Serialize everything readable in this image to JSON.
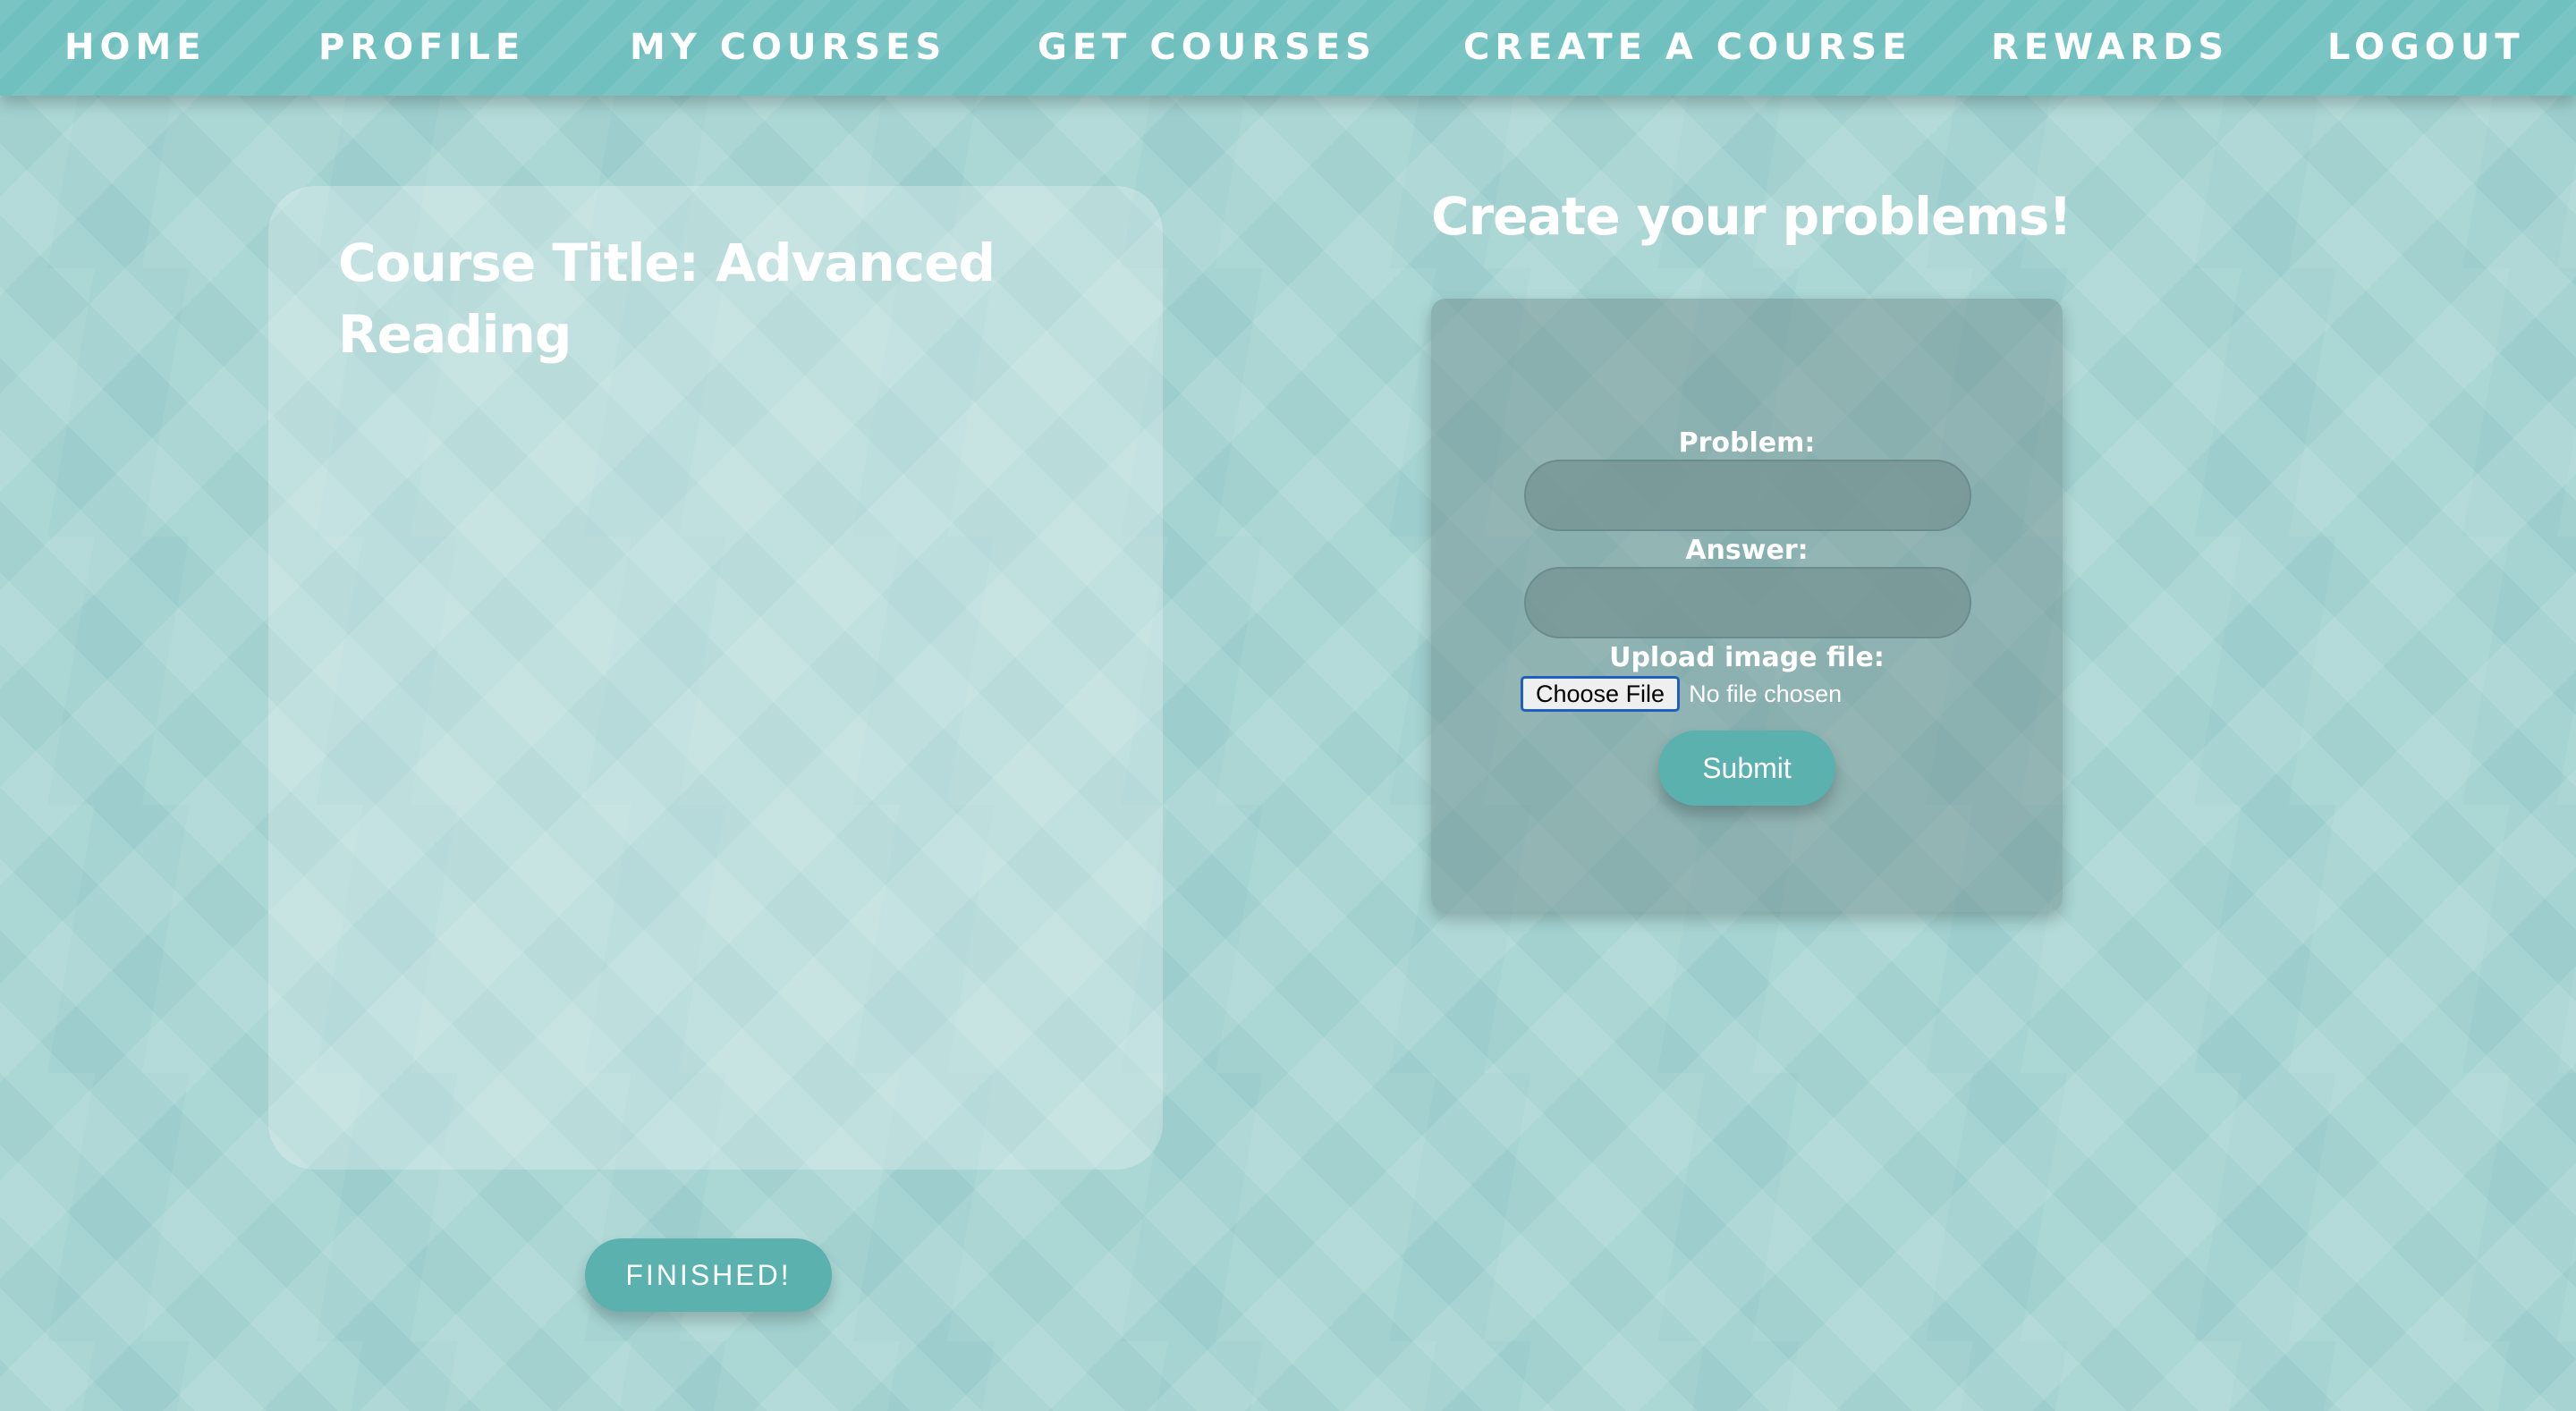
{
  "nav": {
    "items": [
      {
        "label": "Home"
      },
      {
        "label": "Profile"
      },
      {
        "label": "My Courses"
      },
      {
        "label": "Get Courses"
      },
      {
        "label": "Create a Course"
      },
      {
        "label": "Rewards"
      },
      {
        "label": "Logout"
      }
    ]
  },
  "course": {
    "title": "Course Title: Advanced Reading",
    "finished_label": "FINISHED!"
  },
  "form": {
    "heading": "Create your problems!",
    "problem_label": "Problem:",
    "problem_value": "",
    "answer_label": "Answer:",
    "answer_value": "",
    "upload_label": "Upload image file:",
    "choose_file_label": "Choose File",
    "file_status": "No file chosen",
    "submit_label": "Submit"
  },
  "colors": {
    "accent": "#5ab1ae",
    "nav_background": "#6fc0be",
    "page_background": "#a6d4d2"
  }
}
